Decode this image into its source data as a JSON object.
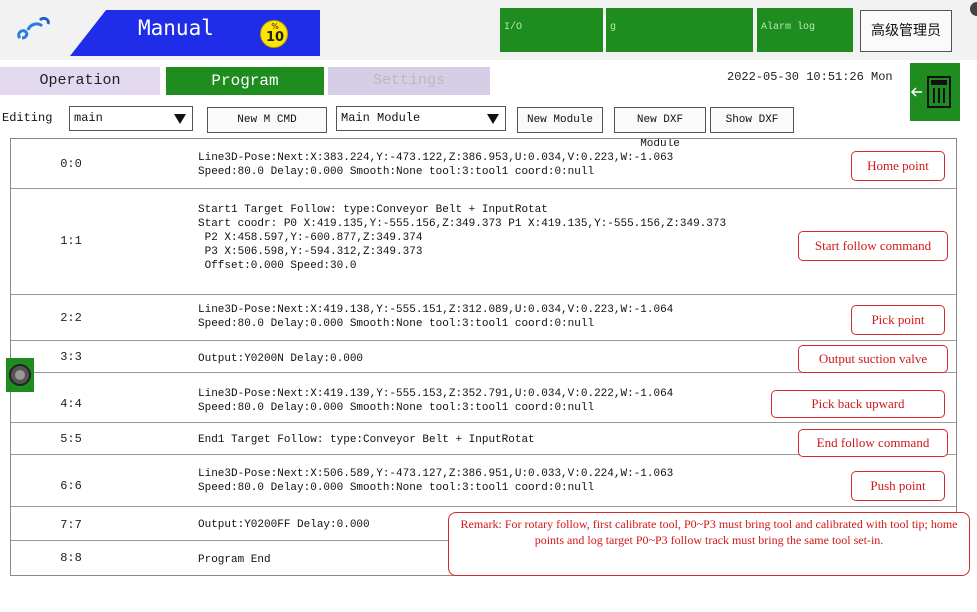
{
  "header": {
    "mode": "Manual",
    "speed_symbol": "%",
    "speed_value": "10",
    "status_boxes": [
      "I/O",
      "g",
      "Alarm log"
    ],
    "user_role": "高级管理员"
  },
  "tabs": {
    "operation": "Operation",
    "program": "Program",
    "settings": "Settings"
  },
  "datetime": "2022-05-30  10:51:26  Mon",
  "toolbar": {
    "editing_label": "Editing",
    "program_select": "main",
    "new_m_cmd": "New M CMD",
    "module_select": "Main Module",
    "new_module": "New Module",
    "new_dxf_module": "New DXF Module",
    "show_dxf": "Show DXF"
  },
  "program_rows": [
    {
      "num": "0:0",
      "lines": "Line3D-Pose:Next:X:383.224,Y:-473.122,Z:386.953,U:0.034,V:0.223,W:-1.063\nSpeed:80.0 Delay:0.000 Smooth:None tool:3:tool1 coord:0:null"
    },
    {
      "num": "1:1",
      "lines": "Start1 Target Follow: type:Conveyor Belt + InputRotat\nStart coodr: P0 X:419.135,Y:-555.156,Z:349.373 P1 X:419.135,Y:-555.156,Z:349.373\n P2 X:458.597,Y:-600.877,Z:349.374\n P3 X:506.598,Y:-594.312,Z:349.373\n Offset:0.000 Speed:30.0"
    },
    {
      "num": "2:2",
      "lines": "Line3D-Pose:Next:X:419.138,Y:-555.151,Z:312.089,U:0.034,V:0.223,W:-1.064\nSpeed:80.0 Delay:0.000 Smooth:None tool:3:tool1 coord:0:null"
    },
    {
      "num": "3:3",
      "lines": "Output:Y0200N Delay:0.000"
    },
    {
      "num": "4:4",
      "lines": "Line3D-Pose:Next:X:419.139,Y:-555.153,Z:352.791,U:0.034,V:0.222,W:-1.064\nSpeed:80.0 Delay:0.000 Smooth:None tool:3:tool1 coord:0:null"
    },
    {
      "num": "5:5",
      "lines": "End1 Target Follow: type:Conveyor Belt + InputRotat"
    },
    {
      "num": "6:6",
      "lines": "Line3D-Pose:Next:X:506.589,Y:-473.127,Z:386.951,U:0.033,V:0.224,W:-1.063\nSpeed:80.0 Delay:0.000 Smooth:None tool:3:tool1 coord:0:null"
    },
    {
      "num": "7:7",
      "lines": "Output:Y0200FF Delay:0.000"
    },
    {
      "num": "8:8",
      "lines": "Program End"
    }
  ],
  "annotations": {
    "home_point": "Home point",
    "start_follow": "Start follow command",
    "pick_point": "Pick point",
    "output_valve": "Output suction valve",
    "pick_back": "Pick back upward",
    "end_follow": "End follow command",
    "push_point": "Push point",
    "remark": "Remark: For rotary follow, first calibrate tool, P0~P3 must bring tool and calibrated with tool tip; home points and log target P0~P3 follow track must bring the same tool set-in."
  },
  "colors": {
    "accent_green": "#1e8c1e",
    "mode_blue": "#1f2de8",
    "annotation_red": "#d01818"
  }
}
